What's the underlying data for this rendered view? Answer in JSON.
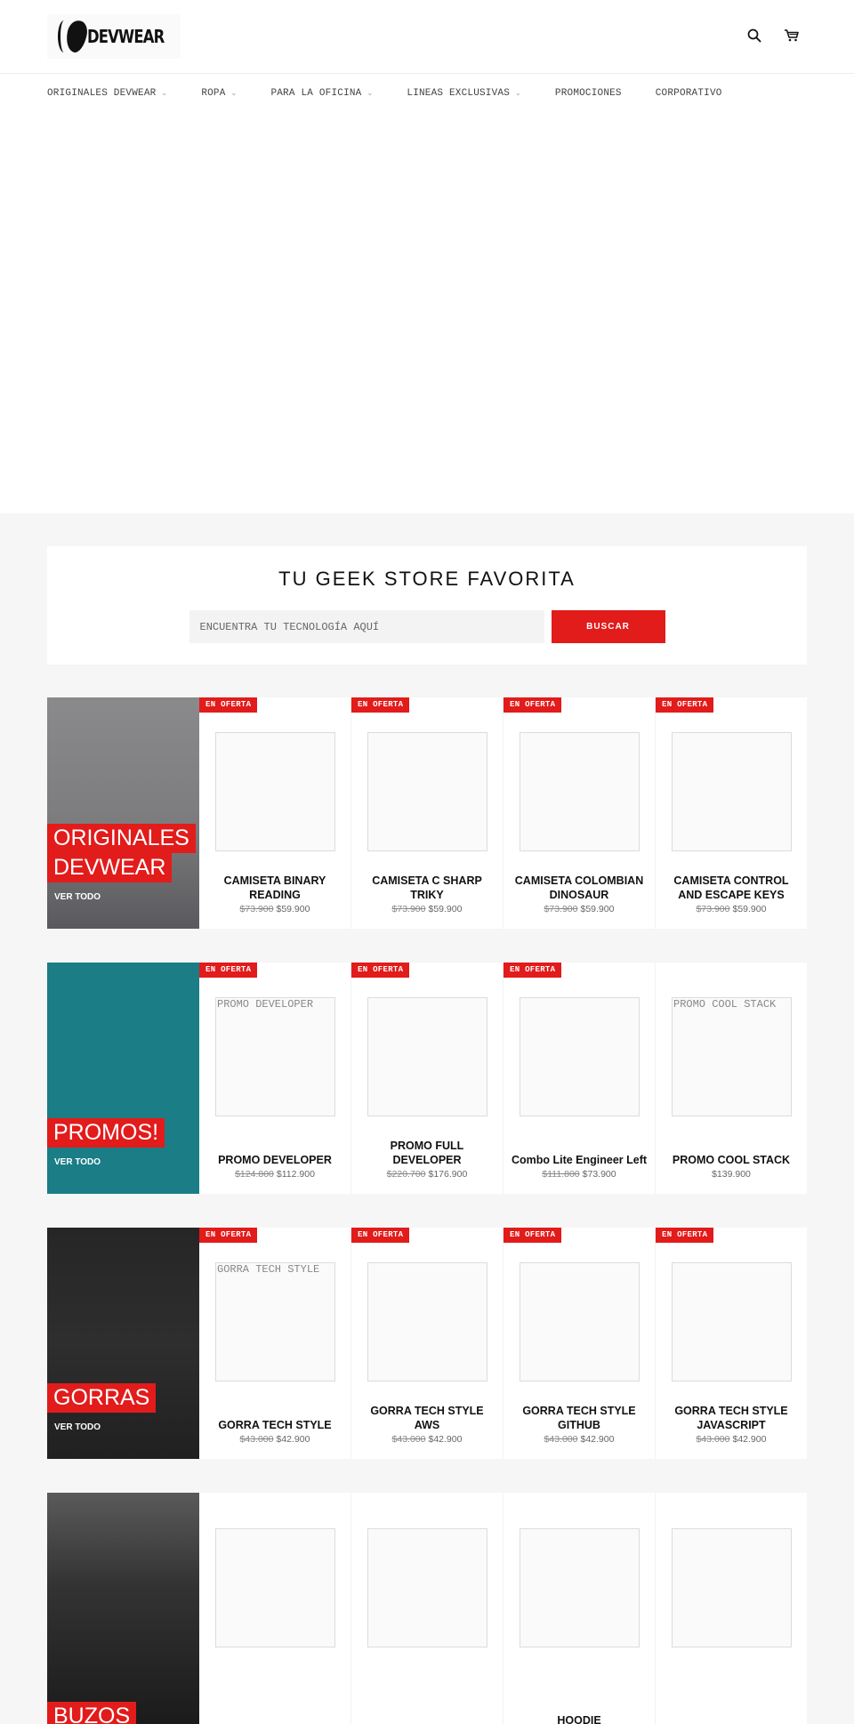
{
  "header": {
    "logo_text": "DEVWEAR",
    "icons": {
      "search": "search-icon",
      "cart": "cart-icon"
    }
  },
  "nav": {
    "items": [
      {
        "label": "ORIGINALES DEVWEAR",
        "has_dropdown": true
      },
      {
        "label": "ROPA",
        "has_dropdown": true
      },
      {
        "label": "PARA LA OFICINA",
        "has_dropdown": true
      },
      {
        "label": "LINEAS EXCLUSIVAS",
        "has_dropdown": true
      },
      {
        "label": "PROMOCIONES",
        "has_dropdown": false
      },
      {
        "label": "CORPORATIVO",
        "has_dropdown": false
      }
    ],
    "dropdown_glyph": "⌄"
  },
  "search": {
    "title": "TU GEEK STORE FAVORITA",
    "placeholder": "ENCUENTRA TU TECNOLOGÍA AQUÍ",
    "value": "",
    "button_label": "BUSCAR"
  },
  "colors": {
    "accent": "#e21b1b",
    "background_gray": "#f6f6f6"
  },
  "collections": [
    {
      "title_lines": [
        "ORIGINALES",
        "DEVWEAR"
      ],
      "link_label": "VER TODO",
      "products": [
        {
          "badge": "EN OFERTA",
          "image_alt": "",
          "name": "CAMISETA BINARY READING",
          "old_price": "$73.900",
          "price": "$59.900"
        },
        {
          "badge": "EN OFERTA",
          "image_alt": "",
          "name": "CAMISETA C SHARP TRIKY",
          "old_price": "$73.900",
          "price": "$59.900"
        },
        {
          "badge": "EN OFERTA",
          "image_alt": "",
          "name": "CAMISETA COLOMBIAN DINOSAUR",
          "old_price": "$73.900",
          "price": "$59.900"
        },
        {
          "badge": "EN OFERTA",
          "image_alt": "",
          "name": "CAMISETA CONTROL AND ESCAPE KEYS",
          "old_price": "$73.900",
          "price": "$59.900"
        }
      ]
    },
    {
      "title_lines": [
        "PROMOS!"
      ],
      "link_label": "VER TODO",
      "products": [
        {
          "badge": "EN OFERTA",
          "image_alt": "PROMO DEVELOPER",
          "name": "PROMO DEVELOPER",
          "old_price": "$124.800",
          "price": "$112.900"
        },
        {
          "badge": "EN OFERTA",
          "image_alt": "",
          "name": "PROMO FULL DEVELOPER",
          "old_price": "$220.700",
          "price": "$176.900"
        },
        {
          "badge": "EN OFERTA",
          "image_alt": "",
          "name": "Combo Lite Engineer Left",
          "old_price": "$111.800",
          "price": "$73.900"
        },
        {
          "badge": "",
          "image_alt": "PROMO COOL STACK",
          "name": "PROMO COOL STACK",
          "old_price": "",
          "price": "$139.900"
        }
      ]
    },
    {
      "title_lines": [
        "GORRAS"
      ],
      "link_label": "VER TODO",
      "products": [
        {
          "badge": "EN OFERTA",
          "image_alt": "GORRA TECH STYLE",
          "name": "GORRA TECH STYLE",
          "old_price": "$43.000",
          "price": "$42.900"
        },
        {
          "badge": "EN OFERTA",
          "image_alt": "",
          "name": "GORRA TECH STYLE AWS",
          "old_price": "$43.000",
          "price": "$42.900"
        },
        {
          "badge": "EN OFERTA",
          "image_alt": "",
          "name": "GORRA TECH STYLE GITHUB",
          "old_price": "$43.000",
          "price": "$42.900"
        },
        {
          "badge": "EN OFERTA",
          "image_alt": "",
          "name": "GORRA TECH STYLE JAVASCRIPT",
          "old_price": "$43.000",
          "price": "$42.900"
        }
      ]
    },
    {
      "title_lines": [
        "BUZOS"
      ],
      "link_label": "",
      "products": [
        {
          "badge": "",
          "image_alt": "",
          "name": "",
          "old_price": "",
          "price": ""
        },
        {
          "badge": "",
          "image_alt": "",
          "name": "",
          "old_price": "",
          "price": ""
        },
        {
          "badge": "",
          "image_alt": "",
          "name": "HOODIE",
          "old_price": "",
          "price": ""
        },
        {
          "badge": "",
          "image_alt": "",
          "name": "",
          "old_price": "",
          "price": ""
        }
      ]
    }
  ]
}
